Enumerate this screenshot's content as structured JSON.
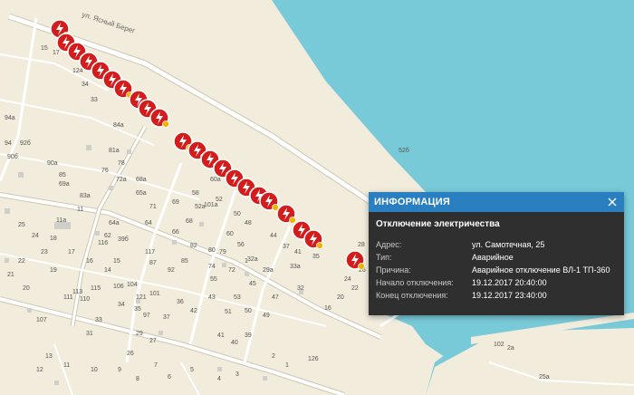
{
  "map": {
    "colors": {
      "land": "#f2ecdc",
      "water": "#78cad8",
      "road": "#ffffff",
      "road_outline": "#cfc6b2",
      "building": "#cfcfc9",
      "marker": "#d41c1c",
      "marker_badge": "#f2b200",
      "text": "#555555"
    },
    "street_label": "ул. Ясный Берег",
    "labels": [
      "15",
      "17",
      "34",
      "33",
      "94а",
      "94",
      "92б",
      "90б",
      "90а",
      "85",
      "83а",
      "84а",
      "81а",
      "78",
      "76",
      "72а",
      "69а",
      "68а",
      "65а",
      "60а",
      "60",
      "58",
      "52",
      "50",
      "48",
      "44",
      "41",
      "39",
      "37",
      "35",
      "33а",
      "32",
      "32а",
      "29а",
      "28",
      "26",
      "24",
      "22",
      "20",
      "16",
      "11",
      "11а",
      "116",
      "115",
      "113",
      "111",
      "110",
      "107",
      "106",
      "104",
      "101",
      "97",
      "92",
      "87",
      "85",
      "82",
      "80",
      "79",
      "74",
      "72",
      "71",
      "69",
      "68",
      "66",
      "64",
      "64а",
      "62",
      "60",
      "56",
      "55",
      "53",
      "51",
      "50",
      "49",
      "47",
      "45",
      "43",
      "42",
      "41",
      "40",
      "39",
      "37",
      "36",
      "35",
      "34",
      "33",
      "31",
      "29",
      "27",
      "26",
      "25",
      "24",
      "23",
      "22",
      "21",
      "20",
      "19",
      "18",
      "17",
      "16",
      "15",
      "14",
      "13",
      "12",
      "11",
      "10",
      "9",
      "8",
      "7",
      "6",
      "5",
      "4",
      "3",
      "2",
      "1",
      "126",
      "124",
      "3а",
      "2а",
      "102",
      "25а",
      "52б",
      "52а",
      "101а",
      "121",
      "117",
      "39б",
      "1",
      "6"
    ]
  },
  "popup": {
    "title": "ИНФОРМАЦИЯ",
    "heading": "Отключение электричества",
    "rows": [
      {
        "key": "Адрес:",
        "value": "ул. Самотечная, 25"
      },
      {
        "key": "Тип:",
        "value": "Аварийное"
      },
      {
        "key": "Причина:",
        "value": "Аварийное отключение ВЛ-1 ТП-360"
      },
      {
        "key": "Начало отключения:",
        "value": "19.12.2017 20:40:00"
      },
      {
        "key": "Конец отключения:",
        "value": "19.12.2017 23:40:00"
      }
    ]
  }
}
